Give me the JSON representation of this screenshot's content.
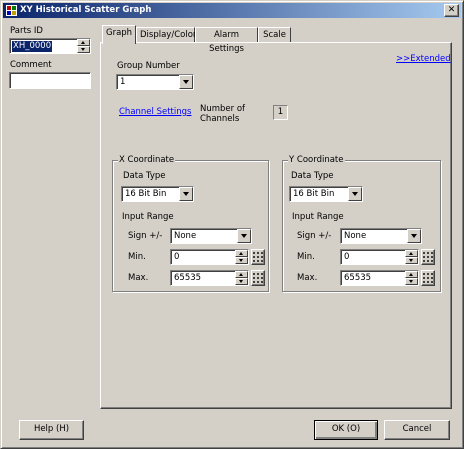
{
  "window": {
    "title": "XY Historical Scatter Graph"
  },
  "left": {
    "parts_id_label": "Parts ID",
    "parts_id_value": "XH_0000",
    "comment_label": "Comment",
    "comment_value": ""
  },
  "tabs": [
    "Graph",
    "Display/Color",
    "Alarm Settings",
    "Scale"
  ],
  "active_tab": "Graph",
  "graph": {
    "extended_link": ">>Extended",
    "group_number_label": "Group Number",
    "group_number_value": "1",
    "channel_settings_link": "Channel Settings",
    "num_channels_label_1": "Number of",
    "num_channels_label_2": "Channels",
    "num_channels_value": "1",
    "x": {
      "title": "X Coordinate",
      "data_type_label": "Data Type",
      "data_type_value": "16 Bit Bin",
      "input_range_label": "Input Range",
      "sign_label": "Sign +/-",
      "sign_value": "None",
      "min_label": "Min.",
      "min_value": "0",
      "max_label": "Max.",
      "max_value": "65535"
    },
    "y": {
      "title": "Y Coordinate",
      "data_type_label": "Data Type",
      "data_type_value": "16 Bit Bin",
      "input_range_label": "Input Range",
      "sign_label": "Sign +/-",
      "sign_value": "None",
      "min_label": "Min.",
      "min_value": "0",
      "max_label": "Max.",
      "max_value": "65535"
    }
  },
  "buttons": {
    "help": "Help (H)",
    "ok": "OK (O)",
    "cancel": "Cancel"
  },
  "colors": {
    "title_start": "#0a246a",
    "title_end": "#a6caf0",
    "face": "#d4d0c8",
    "link": "#0000ff"
  }
}
